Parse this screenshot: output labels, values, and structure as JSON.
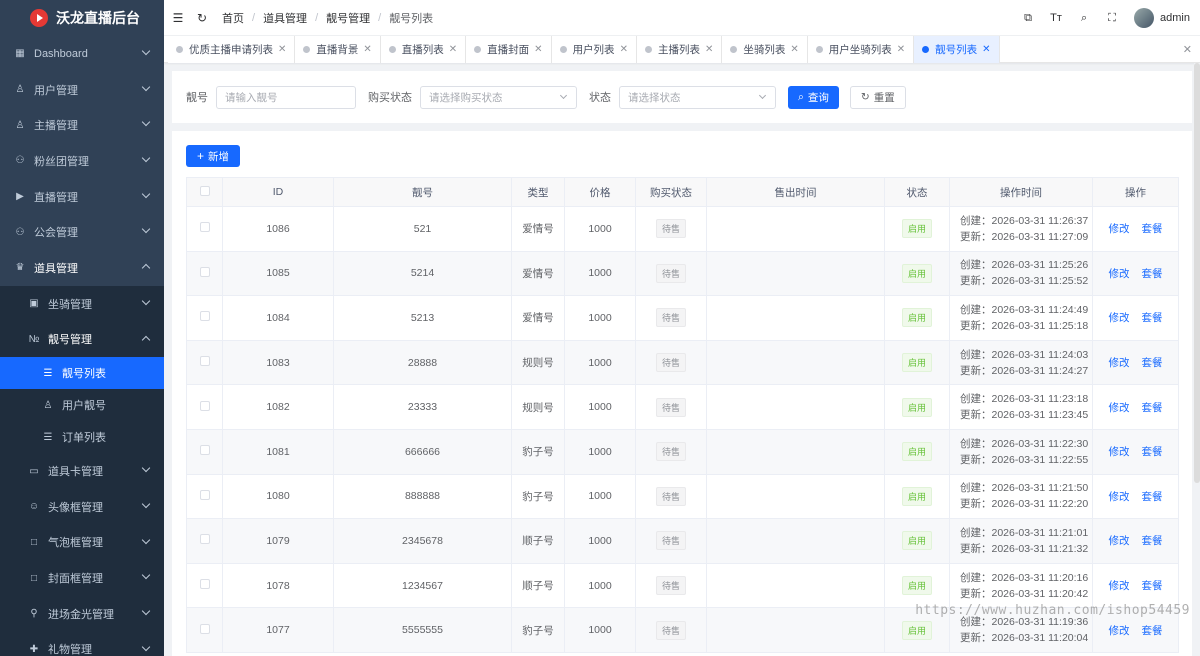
{
  "app": {
    "title": "沃龙直播后台"
  },
  "sidebar": {
    "items": [
      {
        "label": "Dashboard",
        "icon": "grid-icon"
      },
      {
        "label": "用户管理",
        "icon": "user-icon"
      },
      {
        "label": "主播管理",
        "icon": "user-icon"
      },
      {
        "label": "粉丝团管理",
        "icon": "users-icon"
      },
      {
        "label": "直播管理",
        "icon": "video-icon"
      },
      {
        "label": "公会管理",
        "icon": "users-icon"
      },
      {
        "label": "道具管理",
        "icon": "trophy-icon"
      },
      {
        "label": "坐骑管理",
        "icon": "dashboard-icon"
      },
      {
        "label": "靓号管理",
        "icon": "number-icon"
      },
      {
        "label": "靓号列表",
        "icon": "list-icon"
      },
      {
        "label": "用户靓号",
        "icon": "user-icon"
      },
      {
        "label": "订单列表",
        "icon": "list-icon"
      },
      {
        "label": "道具卡管理",
        "icon": "card-icon"
      },
      {
        "label": "头像框管理",
        "icon": "smile-icon"
      },
      {
        "label": "气泡框管理",
        "icon": "square-icon"
      },
      {
        "label": "封面框管理",
        "icon": "square-icon"
      },
      {
        "label": "进场金光管理",
        "icon": "location-icon"
      },
      {
        "label": "礼物管理",
        "icon": "gift-icon"
      }
    ]
  },
  "navbar": {
    "breadcrumb": [
      "首页",
      "道具管理",
      "靓号管理",
      "靓号列表"
    ],
    "user": "admin"
  },
  "tags": [
    "优质主播申请列表",
    "直播背景",
    "直播列表",
    "直播封面",
    "用户列表",
    "主播列表",
    "坐骑列表",
    "用户坐骑列表",
    "靓号列表"
  ],
  "search": {
    "number_label": "靓号",
    "number_placeholder": "请输入靓号",
    "buy_status_label": "购买状态",
    "buy_status_placeholder": "请选择购买状态",
    "status_label": "状态",
    "status_placeholder": "请选择状态",
    "query_label": "查询",
    "reset_label": "重置"
  },
  "toolbar": {
    "add_label": "新增"
  },
  "table": {
    "columns": [
      "ID",
      "靓号",
      "类型",
      "价格",
      "购买状态",
      "售出时间",
      "状态",
      "操作时间",
      "操作"
    ],
    "edit_label": "修改",
    "package_label": "套餐",
    "rows": [
      {
        "id": "1086",
        "number": "521",
        "type": "爱情号",
        "price": "1000",
        "buy_status": "待售",
        "sold_time": "",
        "status": "启用",
        "created": "创建：2026-03-31 11:26:37",
        "updated": "更新：2026-03-31 11:27:09"
      },
      {
        "id": "1085",
        "number": "5214",
        "type": "爱情号",
        "price": "1000",
        "buy_status": "待售",
        "sold_time": "",
        "status": "启用",
        "created": "创建：2026-03-31 11:25:26",
        "updated": "更新：2026-03-31 11:25:52"
      },
      {
        "id": "1084",
        "number": "5213",
        "type": "爱情号",
        "price": "1000",
        "buy_status": "待售",
        "sold_time": "",
        "status": "启用",
        "created": "创建：2026-03-31 11:24:49",
        "updated": "更新：2026-03-31 11:25:18"
      },
      {
        "id": "1083",
        "number": "28888",
        "type": "规则号",
        "price": "1000",
        "buy_status": "待售",
        "sold_time": "",
        "status": "启用",
        "created": "创建：2026-03-31 11:24:03",
        "updated": "更新：2026-03-31 11:24:27"
      },
      {
        "id": "1082",
        "number": "23333",
        "type": "规则号",
        "price": "1000",
        "buy_status": "待售",
        "sold_time": "",
        "status": "启用",
        "created": "创建：2026-03-31 11:23:18",
        "updated": "更新：2026-03-31 11:23:45"
      },
      {
        "id": "1081",
        "number": "666666",
        "type": "豹子号",
        "price": "1000",
        "buy_status": "待售",
        "sold_time": "",
        "status": "启用",
        "created": "创建：2026-03-31 11:22:30",
        "updated": "更新：2026-03-31 11:22:55"
      },
      {
        "id": "1080",
        "number": "888888",
        "type": "豹子号",
        "price": "1000",
        "buy_status": "待售",
        "sold_time": "",
        "status": "启用",
        "created": "创建：2026-03-31 11:21:50",
        "updated": "更新：2026-03-31 11:22:20"
      },
      {
        "id": "1079",
        "number": "2345678",
        "type": "顺子号",
        "price": "1000",
        "buy_status": "待售",
        "sold_time": "",
        "status": "启用",
        "created": "创建：2026-03-31 11:21:01",
        "updated": "更新：2026-03-31 11:21:32"
      },
      {
        "id": "1078",
        "number": "1234567",
        "type": "顺子号",
        "price": "1000",
        "buy_status": "待售",
        "sold_time": "",
        "status": "启用",
        "created": "创建：2026-03-31 11:20:16",
        "updated": "更新：2026-03-31 11:20:42"
      },
      {
        "id": "1077",
        "number": "5555555",
        "type": "豹子号",
        "price": "1000",
        "buy_status": "待售",
        "sold_time": "",
        "status": "启用",
        "created": "创建：2026-03-31 11:19:36",
        "updated": "更新：2026-03-31 11:20:04"
      }
    ]
  },
  "watermark": "https://www.huzhan.com/ishop54459",
  "colors": {
    "primary": "#1769ff",
    "sidebar_bg": "#304156",
    "sidebar_sub_bg": "#1f2d3d"
  }
}
